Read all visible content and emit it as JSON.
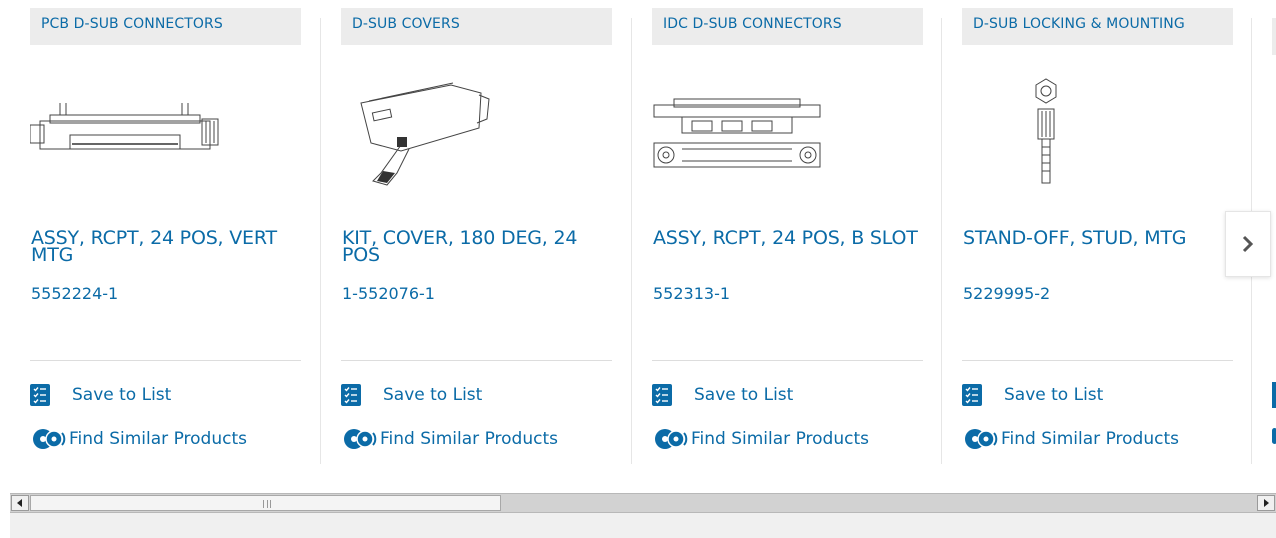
{
  "carousel": {
    "products": [
      {
        "category": "PCB D-SUB CONNECTORS",
        "title": "ASSY, RCPT, 24 POS, VERT MTG",
        "part_number": "5552224-1",
        "image_icon": "pcb-connector-drawing"
      },
      {
        "category": "D-SUB COVERS",
        "title": "KIT, COVER, 180 DEG, 24 POS",
        "part_number": "1-552076-1",
        "image_icon": "cover-kit-drawing"
      },
      {
        "category": "IDC D-SUB CONNECTORS",
        "title": "ASSY, RCPT, 24 POS, B SLOT",
        "part_number": "552313-1",
        "image_icon": "idc-connector-drawing"
      },
      {
        "category": "D-SUB LOCKING & MOUNTING",
        "title": "STAND-OFF, STUD, MTG",
        "part_number": "5229995-2",
        "image_icon": "standoff-drawing"
      }
    ],
    "actions": {
      "save_label": "Save to List",
      "similar_label": "Find Similar Products"
    },
    "next_icon": "chevron-right-icon"
  },
  "colors": {
    "accent": "#0b6ba7",
    "top_accent": "#f28c28",
    "category_bg": "#ececec"
  }
}
